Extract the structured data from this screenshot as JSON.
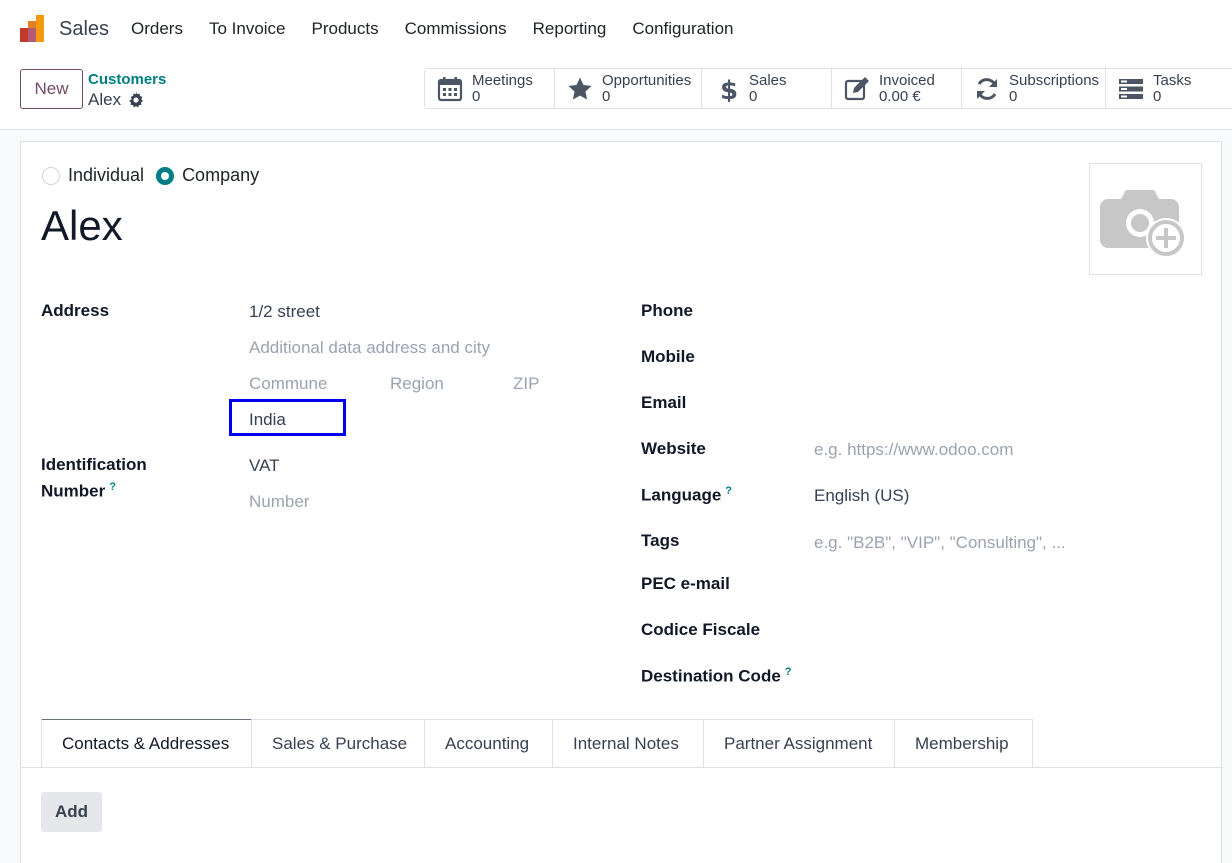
{
  "navbar": {
    "app_name": "Sales",
    "menu": [
      "Orders",
      "To Invoice",
      "Products",
      "Commissions",
      "Reporting",
      "Configuration"
    ]
  },
  "control": {
    "new_label": "New",
    "breadcrumb_parent": "Customers",
    "breadcrumb_current": "Alex",
    "smart_buttons": [
      {
        "label": "Meetings",
        "value": "0",
        "icon": "calendar-icon"
      },
      {
        "label": "Opportunities",
        "value": "0",
        "icon": "star-icon"
      },
      {
        "label": "Sales",
        "value": "0",
        "icon": "dollar-icon"
      },
      {
        "label": "Invoiced",
        "value": "0.00 €",
        "icon": "edit-icon"
      },
      {
        "label": "Subscriptions",
        "value": "0",
        "icon": "refresh-icon"
      },
      {
        "label": "Tasks",
        "value": "0",
        "icon": "tasks-icon"
      }
    ]
  },
  "form": {
    "company_type": {
      "individual": "Individual",
      "company": "Company",
      "selected": "Company"
    },
    "name": "Alex",
    "address": {
      "label": "Address",
      "street": "1/2 street",
      "street2_placeholder": "Additional data address and city",
      "city_placeholder": "Commune",
      "state_placeholder": "Region",
      "zip_placeholder": "ZIP",
      "country": "India"
    },
    "identification": {
      "label_line1": "Identification",
      "label_line2": "Number",
      "help": "?",
      "vat": "VAT",
      "number_placeholder": "Number"
    },
    "right": {
      "phone_label": "Phone",
      "mobile_label": "Mobile",
      "email_label": "Email",
      "website_label": "Website",
      "website_placeholder": "e.g. https://www.odoo.com",
      "language_label": "Language",
      "language_help": "?",
      "language_value": "English (US)",
      "tags_label": "Tags",
      "tags_placeholder": "e.g. \"B2B\", \"VIP\", \"Consulting\", ...",
      "pec_label": "PEC e-mail",
      "codice_label": "Codice Fiscale",
      "destination_label": "Destination Code",
      "destination_help": "?"
    }
  },
  "tabs": [
    "Contacts & Addresses",
    "Sales & Purchase",
    "Accounting",
    "Internal Notes",
    "Partner Assignment",
    "Membership"
  ],
  "add_label": "Add",
  "colors": {
    "brand": "#714b67",
    "accent": "#017e84",
    "highlight": "#0000ee"
  }
}
